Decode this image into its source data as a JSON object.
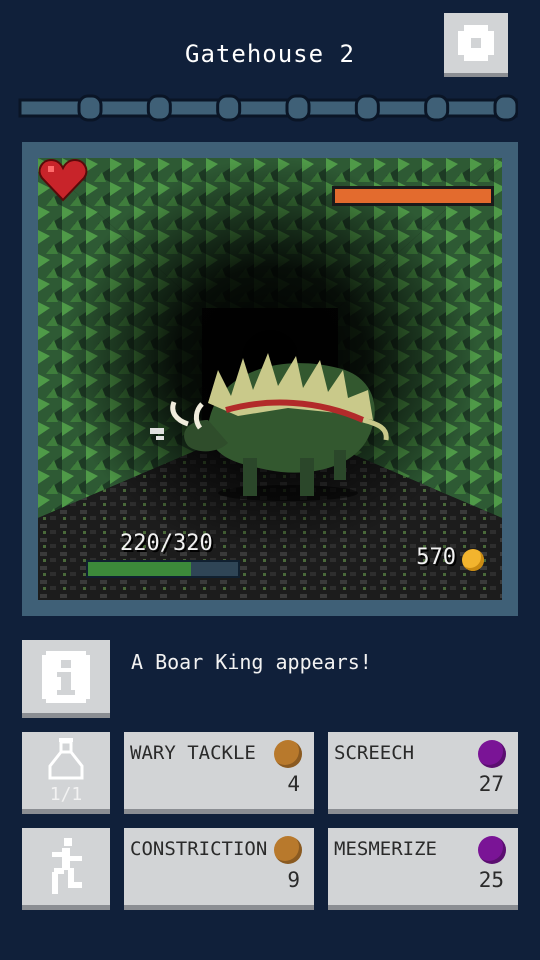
{
  "header": {
    "title": "Gatehouse 2"
  },
  "progress": {
    "total_nodes": 7,
    "completed_nodes": 0
  },
  "colors": {
    "panel": "#3f6077",
    "stone": "#d2d4d6",
    "dot_orange": "#b8792c",
    "dot_purple": "#7a1496",
    "enemy_hp": "#e36b2e",
    "player_hp": "#3c8a3a",
    "gold": "#f2b42e"
  },
  "enemy": {
    "hp_fraction": 1.0
  },
  "player": {
    "hp_text": "220/320",
    "hp_fraction": 0.6875,
    "gold": "570"
  },
  "log": {
    "message": "A Boar King appears!"
  },
  "potion": {
    "count_text": "1/1",
    "icon": "potion-icon"
  },
  "flee": {
    "icon": "running-man-icon"
  },
  "skills": [
    {
      "name": "WARY TACKLE",
      "cost": "4",
      "color": "#b8792c"
    },
    {
      "name": "SCREECH",
      "cost": "27",
      "color": "#7a1496"
    },
    {
      "name": "CONSTRICTION",
      "cost": "9",
      "color": "#b8792c"
    },
    {
      "name": "MESMERIZE",
      "cost": "25",
      "color": "#7a1496"
    }
  ]
}
